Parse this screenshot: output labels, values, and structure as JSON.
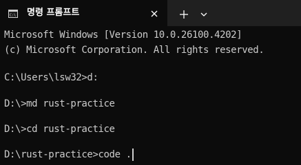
{
  "tab": {
    "title": "명령 프롬프트",
    "icon": "terminal-icon",
    "close_icon": "close-icon"
  },
  "toolbar": {
    "new_tab_icon": "plus-icon",
    "dropdown_icon": "chevron-down-icon"
  },
  "terminal": {
    "lines": [
      "Microsoft Windows [Version 10.0.26100.4202]",
      "(c) Microsoft Corporation. All rights reserved.",
      "C:\\Users\\lsw32>d:",
      "D:\\>md rust-practice",
      "D:\\>cd rust-practice",
      "D:\\rust-practice>code ."
    ]
  },
  "colors": {
    "background": "#0c0c0c",
    "titlebar": "#202020",
    "text": "#cccccc"
  }
}
